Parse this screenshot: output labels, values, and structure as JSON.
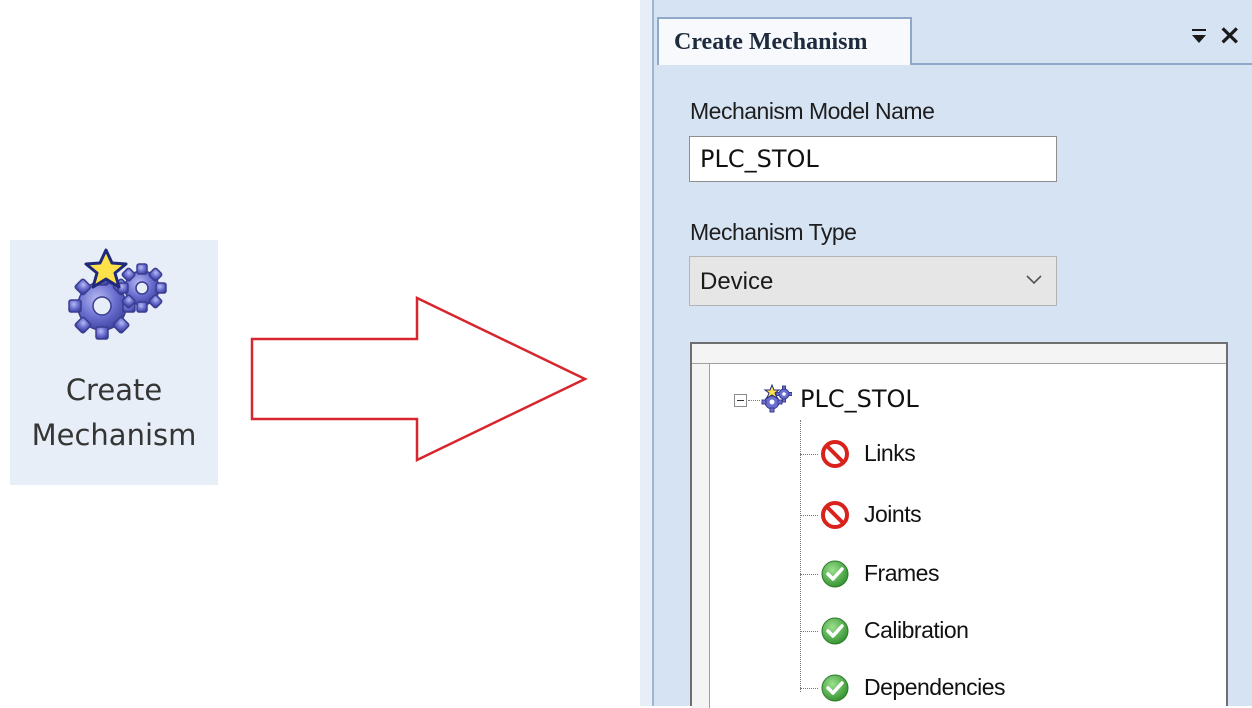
{
  "ribbon_button": {
    "line1": "Create",
    "line2": "Mechanism",
    "icon": "gears-star-icon"
  },
  "panel": {
    "tab_title": "Create Mechanism",
    "pin_icon": "pin-dropdown-icon",
    "close_label": "×",
    "model_name_label": "Mechanism Model Name",
    "model_name_value": "PLC_STOL",
    "type_label": "Mechanism Type",
    "type_value": "Device",
    "tree": {
      "root_label": "PLC_STOL",
      "root_icon": "mechanism-gears-icon",
      "items": [
        {
          "label": "Links",
          "status": "error",
          "icon": "no-entry-icon"
        },
        {
          "label": "Joints",
          "status": "error",
          "icon": "no-entry-icon"
        },
        {
          "label": "Frames",
          "status": "ok",
          "icon": "check-circle-icon"
        },
        {
          "label": "Calibration",
          "status": "ok",
          "icon": "check-circle-icon"
        },
        {
          "label": "Dependencies",
          "status": "ok",
          "icon": "check-circle-icon"
        }
      ]
    }
  },
  "colors": {
    "arrow_stroke": "#d7262e",
    "panel_bg": "#d6e3f3",
    "error_red": "#d9221c",
    "ok_green": "#3fa33d"
  }
}
